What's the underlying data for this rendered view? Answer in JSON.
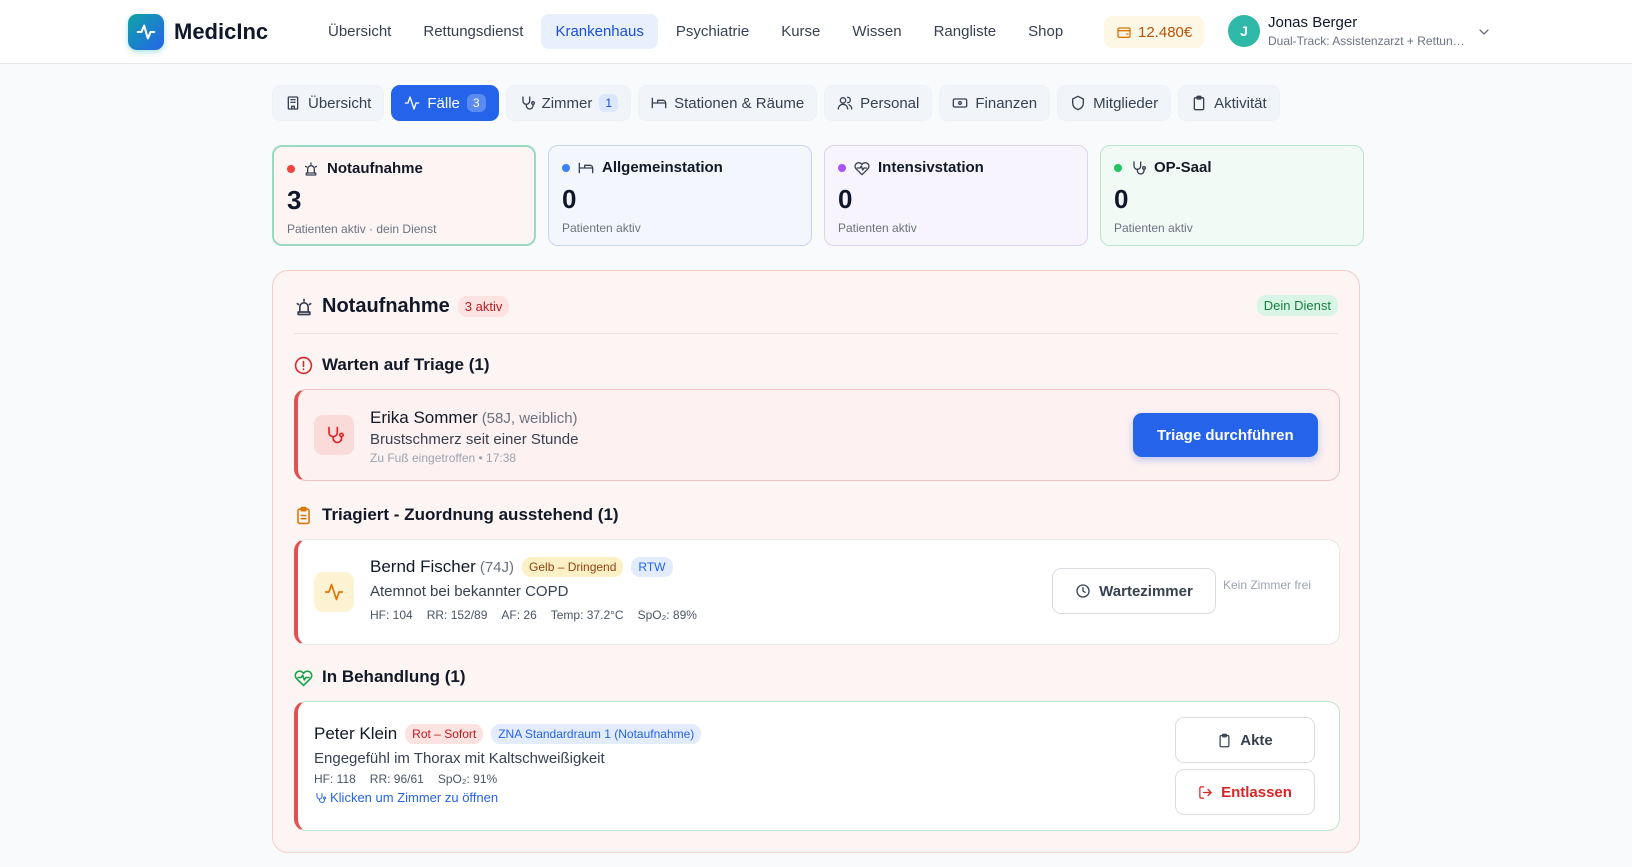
{
  "app": {
    "name": "MedicInc"
  },
  "nav": [
    "Übersicht",
    "Rettungsdienst",
    "Krankenhaus",
    "Psychiatrie",
    "Kurse",
    "Wissen",
    "Rangliste",
    "Shop"
  ],
  "nav_active": "Krankenhaus",
  "wallet": {
    "amount": "12.480€"
  },
  "user": {
    "initial": "J",
    "name": "Jonas Berger",
    "role": "Dual-Track: Assistenzarzt + Rettung..."
  },
  "tabs": [
    {
      "label": "Übersicht",
      "icon": "building-icon"
    },
    {
      "label": "Fälle",
      "icon": "activity-icon",
      "count": "3",
      "active": true
    },
    {
      "label": "Zimmer",
      "icon": "stethoscope-icon",
      "count": "1"
    },
    {
      "label": "Stationen & Räume",
      "icon": "bed-icon"
    },
    {
      "label": "Personal",
      "icon": "users-icon"
    },
    {
      "label": "Finanzen",
      "icon": "banknote-icon"
    },
    {
      "label": "Mitglieder",
      "icon": "shield-icon"
    },
    {
      "label": "Aktivität",
      "icon": "clipboard-icon"
    }
  ],
  "stations": [
    {
      "name": "Notaufnahme",
      "count": "3",
      "sub": "Patienten aktiv · dein Dienst",
      "dot": "#ef4444",
      "icon": "siren-icon"
    },
    {
      "name": "Allgemeinstation",
      "count": "0",
      "sub": "Patienten aktiv",
      "dot": "#3b82f6",
      "icon": "bed-icon"
    },
    {
      "name": "Intensivstation",
      "count": "0",
      "sub": "Patienten aktiv",
      "dot": "#a855f7",
      "icon": "heart-pulse-icon"
    },
    {
      "name": "OP-Saal",
      "count": "0",
      "sub": "Patienten aktiv",
      "dot": "#22c55e",
      "icon": "stethoscope-icon"
    }
  ],
  "panel": {
    "title": "Notaufnahme",
    "active_badge": "3 aktiv",
    "duty_badge": "Dein Dienst",
    "sections": {
      "triage": "Warten auf Triage (1)",
      "assigned": "Triagiert - Zuordnung ausstehend (1)",
      "treatment": "In Behandlung (1)"
    },
    "case_triage": {
      "name": "Erika Sommer",
      "meta": "(58J, weiblich)",
      "complaint": "Brustschmerz seit einer Stunde",
      "arrival": "Zu Fuß eingetroffen • 17:38",
      "button": "Triage durchführen"
    },
    "case_assigned": {
      "name": "Bernd Fischer",
      "meta": "(74J)",
      "priority": "Gelb – Dringend",
      "transport": "RTW",
      "complaint": "Atemnot bei bekannter COPD",
      "vitals": [
        "HF: 104",
        "RR: 152/89",
        "AF: 26",
        "Temp: 37.2°C",
        "SpO₂: 89%"
      ],
      "button": "Wartezimmer",
      "note": "Kein Zimmer frei"
    },
    "case_treatment": {
      "name": "Peter Klein",
      "priority": "Rot – Sofort",
      "room": "ZNA Standardraum 1 (Notaufnahme)",
      "complaint": "Engegefühl im Thorax mit Kaltschweißigkeit",
      "vitals": [
        "HF: 118",
        "RR: 96/61",
        "SpO₂: 91%"
      ],
      "room_link": "Klicken um Zimmer zu öffnen",
      "btn_file": "Akte",
      "btn_discharge": "Entlassen"
    }
  },
  "colors": {
    "primary": "#2563eb",
    "danger": "#dc2626",
    "accent": "#0ea5a4"
  }
}
